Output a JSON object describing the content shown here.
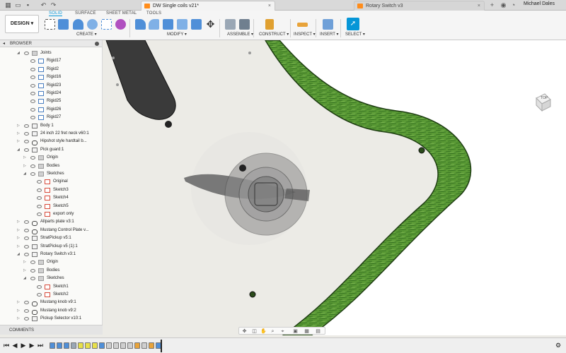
{
  "titlebar": {
    "tabs": [
      {
        "label": "DW Single coils v21*",
        "active": true
      },
      {
        "label": "Rotary Switch v3",
        "active": false
      }
    ],
    "user_name": "Michael Dales"
  },
  "toolbar": {
    "workspace": "DESIGN",
    "mode_tabs": [
      "SOLID",
      "SURFACE",
      "SHEET METAL",
      "TOOLS"
    ],
    "groups": [
      "CREATE",
      "MODIFY",
      "ASSEMBLE",
      "CONSTRUCT",
      "INSPECT",
      "INSERT",
      "SELECT"
    ],
    "accent": "#0696d7"
  },
  "browser": {
    "title": "BROWSER",
    "items": [
      {
        "label": "Joints",
        "type": "folder",
        "level": 0,
        "expanded": true
      },
      {
        "label": "Rigid17",
        "type": "joint",
        "level": 1
      },
      {
        "label": "Rigid2",
        "type": "joint",
        "level": 1
      },
      {
        "label": "Rigid16",
        "type": "joint",
        "level": 1
      },
      {
        "label": "Rigid23",
        "type": "joint",
        "level": 1
      },
      {
        "label": "Rigid24",
        "type": "joint",
        "level": 1
      },
      {
        "label": "Rigid25",
        "type": "joint",
        "level": 1
      },
      {
        "label": "Rigid26",
        "type": "joint",
        "level": 1
      },
      {
        "label": "Rigid27",
        "type": "joint",
        "level": 1
      },
      {
        "label": "Body 1",
        "type": "comp",
        "level": 0
      },
      {
        "label": "24 inch 22 fret neck v60:1",
        "type": "comp",
        "level": 0
      },
      {
        "label": "Hipshot style hardtail b...",
        "type": "link",
        "level": 0
      },
      {
        "label": "Pick guard:1",
        "type": "comp",
        "level": 0,
        "expanded": true
      },
      {
        "label": "Origin",
        "type": "folder",
        "level": 1
      },
      {
        "label": "Bodies",
        "type": "folder",
        "level": 1
      },
      {
        "label": "Sketches",
        "type": "folder",
        "level": 1,
        "expanded": true
      },
      {
        "label": "Original",
        "type": "sketch",
        "level": 2
      },
      {
        "label": "Sketch3",
        "type": "sketch",
        "level": 2
      },
      {
        "label": "Sketch4",
        "type": "sketch",
        "level": 2
      },
      {
        "label": "Sketch5",
        "type": "sketch",
        "level": 2
      },
      {
        "label": "export only",
        "type": "sketch",
        "level": 2
      },
      {
        "label": "Allparts plate v3:1",
        "type": "link",
        "level": 0
      },
      {
        "label": "Mustang Control Plate v...",
        "type": "link",
        "level": 0
      },
      {
        "label": "StratPickup v5:1",
        "type": "comp",
        "level": 0
      },
      {
        "label": "StratPickup v5 (1):1",
        "type": "comp",
        "level": 0
      },
      {
        "label": "Rotary Switch v3:1",
        "type": "comp",
        "level": 0,
        "expanded": true
      },
      {
        "label": "Origin",
        "type": "folder",
        "level": 1
      },
      {
        "label": "Bodies",
        "type": "folder",
        "level": 1
      },
      {
        "label": "Sketches",
        "type": "folder",
        "level": 1,
        "expanded": true
      },
      {
        "label": "Sketch1",
        "type": "sketch",
        "level": 2
      },
      {
        "label": "Sketch2",
        "type": "sketch",
        "level": 2
      },
      {
        "label": "Mustang knob v9:1",
        "type": "link",
        "level": 0
      },
      {
        "label": "Mustang knob v9:2",
        "type": "link",
        "level": 0
      },
      {
        "label": "Pickup Selector v10:1",
        "type": "comp",
        "level": 0
      }
    ]
  },
  "comments": {
    "label": "COMMENTS"
  },
  "viewcube": {
    "face": "TOP"
  },
  "colors": {
    "body_green": "#4f8f2f",
    "pickguard": "#ecebe6",
    "background": "#ffffff"
  }
}
